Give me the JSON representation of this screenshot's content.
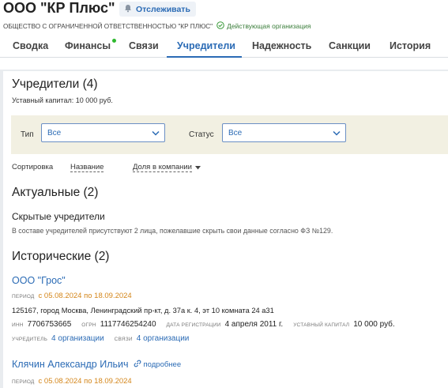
{
  "company": {
    "title": "ООО \"КР Плюс\"",
    "follow_label": "Отслеживать",
    "full_name": "ОБЩЕСТВО С ОГРАНИЧЕННОЙ ОТВЕТСТВЕННОСТЬЮ \"КР ПЛЮС\"",
    "status": "Действующая организация"
  },
  "tabs": [
    {
      "label": "Сводка"
    },
    {
      "label": "Финансы"
    },
    {
      "label": "Связи"
    },
    {
      "label": "Учредители",
      "active": true
    },
    {
      "label": "Надежность"
    },
    {
      "label": "Санкции"
    },
    {
      "label": "История"
    }
  ],
  "founders": {
    "title": "Учредители (4)",
    "capital": "Уставный капитал: 10 000 руб.",
    "filters": {
      "type_label": "Тип",
      "type_value": "Все",
      "status_label": "Статус",
      "status_value": "Все"
    },
    "sort": {
      "label": "Сортировка",
      "by_name": "Название",
      "by_share": "Доля в компании"
    },
    "current": {
      "title": "Актуальные (2)",
      "hidden_title": "Скрытые учредители",
      "hidden_note": "В составе учредителей присутствуют 2 лица, пожелавшие скрыть свои данные согласно ФЗ №129."
    },
    "historic": {
      "title": "Исторические (2)",
      "items": [
        {
          "name": "ООО \"Грос\"",
          "period_label": "период",
          "period": "с 05.08.2024 по 18.09.2024",
          "address": "125167, город Москва, Ленинградский пр-кт, д. 37а к. 4, эт 10 комната 24 а31",
          "inn_label": "инн",
          "inn": "7706753665",
          "ogrn_label": "огрн",
          "ogrn": "1117746254240",
          "reg_label": "дата регистрации",
          "reg_date": "4 апреля 2011 г.",
          "capital_label": "уставный капитал",
          "capital": "10 000 руб.",
          "founder_label": "учредитель",
          "founder_value": "4 организации",
          "links_label": "связи",
          "links_value": "4 организации"
        },
        {
          "name": "Клячин Александр Ильич",
          "more_label": "подробнее",
          "period_label": "период",
          "period": "с 05.08.2024 по 18.09.2024"
        }
      ]
    }
  },
  "colors": {
    "accent": "#2b6bb5",
    "period": "#d4861a",
    "status_ok": "#3a7d3a",
    "filter_bg": "#f2f0e2"
  }
}
